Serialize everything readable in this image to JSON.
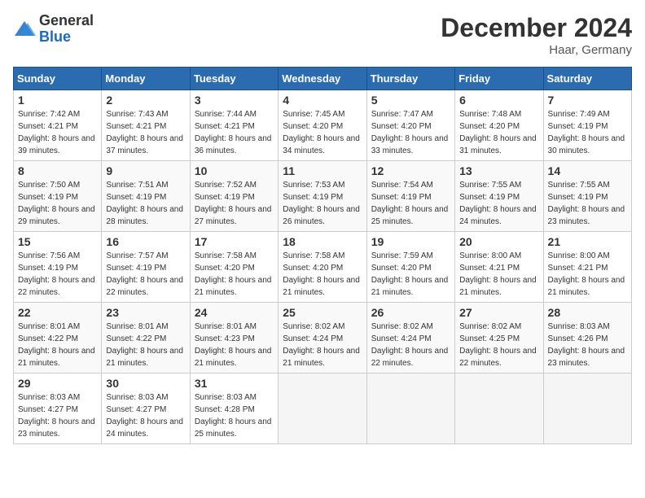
{
  "logo": {
    "text_general": "General",
    "text_blue": "Blue"
  },
  "title": "December 2024",
  "subtitle": "Haar, Germany",
  "days_of_week": [
    "Sunday",
    "Monday",
    "Tuesday",
    "Wednesday",
    "Thursday",
    "Friday",
    "Saturday"
  ],
  "weeks": [
    [
      {
        "day": "1",
        "sunrise": "7:42 AM",
        "sunset": "4:21 PM",
        "daylight": "8 hours and 39 minutes."
      },
      {
        "day": "2",
        "sunrise": "7:43 AM",
        "sunset": "4:21 PM",
        "daylight": "8 hours and 37 minutes."
      },
      {
        "day": "3",
        "sunrise": "7:44 AM",
        "sunset": "4:21 PM",
        "daylight": "8 hours and 36 minutes."
      },
      {
        "day": "4",
        "sunrise": "7:45 AM",
        "sunset": "4:20 PM",
        "daylight": "8 hours and 34 minutes."
      },
      {
        "day": "5",
        "sunrise": "7:47 AM",
        "sunset": "4:20 PM",
        "daylight": "8 hours and 33 minutes."
      },
      {
        "day": "6",
        "sunrise": "7:48 AM",
        "sunset": "4:20 PM",
        "daylight": "8 hours and 31 minutes."
      },
      {
        "day": "7",
        "sunrise": "7:49 AM",
        "sunset": "4:19 PM",
        "daylight": "8 hours and 30 minutes."
      }
    ],
    [
      {
        "day": "8",
        "sunrise": "7:50 AM",
        "sunset": "4:19 PM",
        "daylight": "8 hours and 29 minutes."
      },
      {
        "day": "9",
        "sunrise": "7:51 AM",
        "sunset": "4:19 PM",
        "daylight": "8 hours and 28 minutes."
      },
      {
        "day": "10",
        "sunrise": "7:52 AM",
        "sunset": "4:19 PM",
        "daylight": "8 hours and 27 minutes."
      },
      {
        "day": "11",
        "sunrise": "7:53 AM",
        "sunset": "4:19 PM",
        "daylight": "8 hours and 26 minutes."
      },
      {
        "day": "12",
        "sunrise": "7:54 AM",
        "sunset": "4:19 PM",
        "daylight": "8 hours and 25 minutes."
      },
      {
        "day": "13",
        "sunrise": "7:55 AM",
        "sunset": "4:19 PM",
        "daylight": "8 hours and 24 minutes."
      },
      {
        "day": "14",
        "sunrise": "7:55 AM",
        "sunset": "4:19 PM",
        "daylight": "8 hours and 23 minutes."
      }
    ],
    [
      {
        "day": "15",
        "sunrise": "7:56 AM",
        "sunset": "4:19 PM",
        "daylight": "8 hours and 22 minutes."
      },
      {
        "day": "16",
        "sunrise": "7:57 AM",
        "sunset": "4:19 PM",
        "daylight": "8 hours and 22 minutes."
      },
      {
        "day": "17",
        "sunrise": "7:58 AM",
        "sunset": "4:20 PM",
        "daylight": "8 hours and 21 minutes."
      },
      {
        "day": "18",
        "sunrise": "7:58 AM",
        "sunset": "4:20 PM",
        "daylight": "8 hours and 21 minutes."
      },
      {
        "day": "19",
        "sunrise": "7:59 AM",
        "sunset": "4:20 PM",
        "daylight": "8 hours and 21 minutes."
      },
      {
        "day": "20",
        "sunrise": "8:00 AM",
        "sunset": "4:21 PM",
        "daylight": "8 hours and 21 minutes."
      },
      {
        "day": "21",
        "sunrise": "8:00 AM",
        "sunset": "4:21 PM",
        "daylight": "8 hours and 21 minutes."
      }
    ],
    [
      {
        "day": "22",
        "sunrise": "8:01 AM",
        "sunset": "4:22 PM",
        "daylight": "8 hours and 21 minutes."
      },
      {
        "day": "23",
        "sunrise": "8:01 AM",
        "sunset": "4:22 PM",
        "daylight": "8 hours and 21 minutes."
      },
      {
        "day": "24",
        "sunrise": "8:01 AM",
        "sunset": "4:23 PM",
        "daylight": "8 hours and 21 minutes."
      },
      {
        "day": "25",
        "sunrise": "8:02 AM",
        "sunset": "4:24 PM",
        "daylight": "8 hours and 21 minutes."
      },
      {
        "day": "26",
        "sunrise": "8:02 AM",
        "sunset": "4:24 PM",
        "daylight": "8 hours and 22 minutes."
      },
      {
        "day": "27",
        "sunrise": "8:02 AM",
        "sunset": "4:25 PM",
        "daylight": "8 hours and 22 minutes."
      },
      {
        "day": "28",
        "sunrise": "8:03 AM",
        "sunset": "4:26 PM",
        "daylight": "8 hours and 23 minutes."
      }
    ],
    [
      {
        "day": "29",
        "sunrise": "8:03 AM",
        "sunset": "4:27 PM",
        "daylight": "8 hours and 23 minutes."
      },
      {
        "day": "30",
        "sunrise": "8:03 AM",
        "sunset": "4:27 PM",
        "daylight": "8 hours and 24 minutes."
      },
      {
        "day": "31",
        "sunrise": "8:03 AM",
        "sunset": "4:28 PM",
        "daylight": "8 hours and 25 minutes."
      },
      null,
      null,
      null,
      null
    ]
  ]
}
